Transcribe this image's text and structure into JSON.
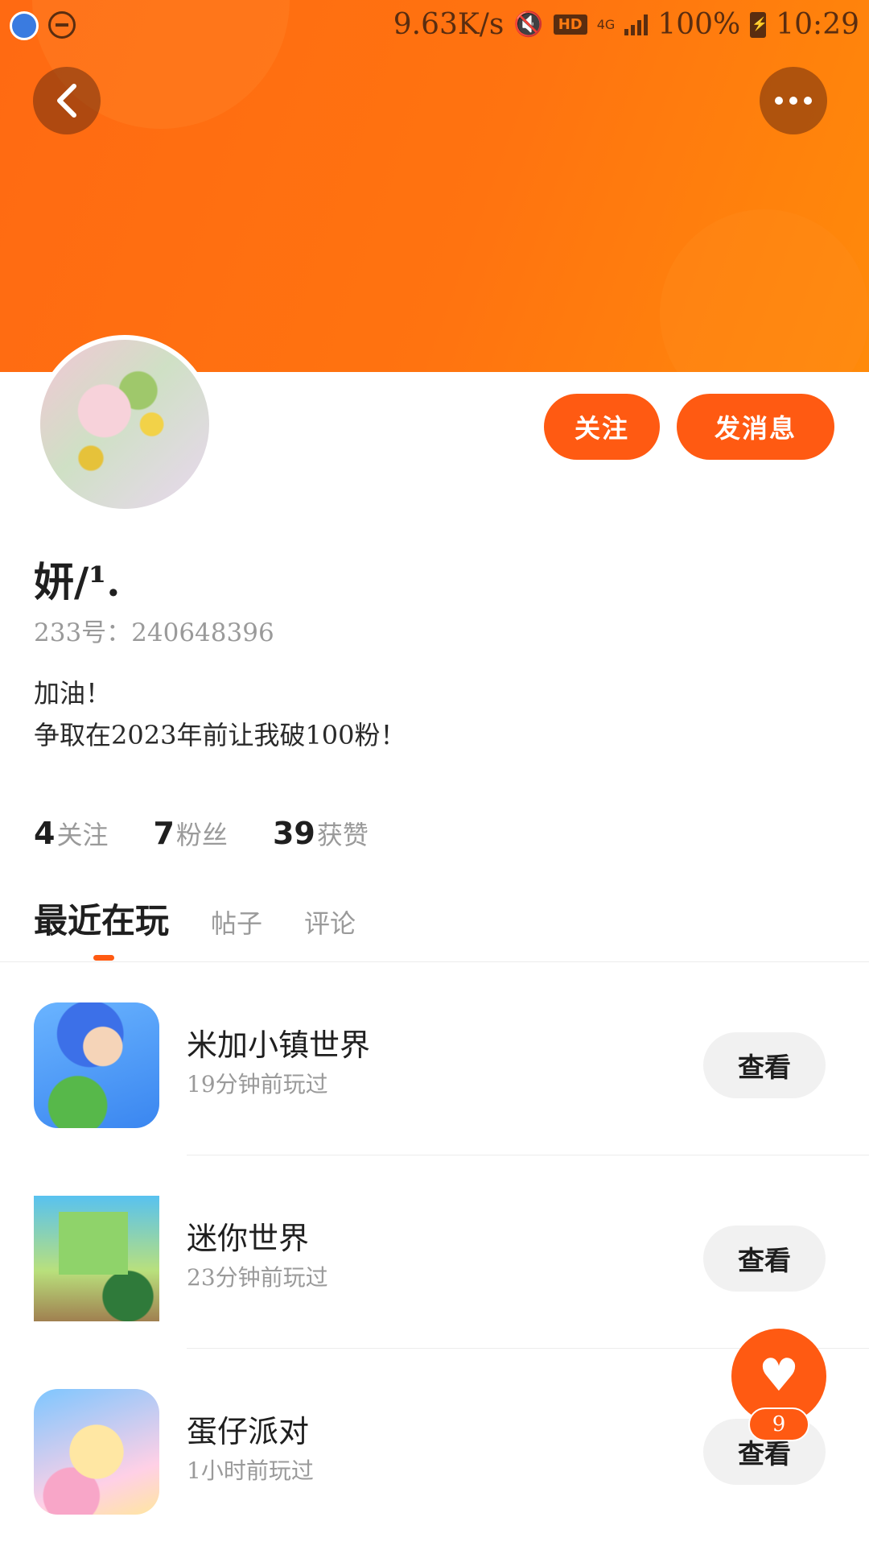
{
  "status_bar": {
    "net_speed": "9.63K/s",
    "hd": "HD",
    "network": "4G",
    "battery": "100%",
    "time": "10:29"
  },
  "header": {
    "back_icon": "chevron-left-icon",
    "more_icon": "more-dots-icon",
    "background_color": "#ff7210"
  },
  "profile": {
    "nickname": "妍/¹.",
    "uid": "233号：240648396",
    "bio_line1": "加油！",
    "bio_line2": "争取在2023年前让我破100粉！",
    "follow_label": "关注",
    "message_label": "发消息"
  },
  "stats": {
    "following_count": "4",
    "following_label": "关注",
    "fans_count": "7",
    "fans_label": "粉丝",
    "likes_count": "39",
    "likes_label": "获赞"
  },
  "tabs": [
    {
      "label": "最近在玩",
      "active": true
    },
    {
      "label": "帖子",
      "active": false
    },
    {
      "label": "评论",
      "active": false
    }
  ],
  "games": [
    {
      "name": "米加小镇世界",
      "time": "19分钟前玩过",
      "action": "查看"
    },
    {
      "name": "迷你世界",
      "time": "23分钟前玩过",
      "action": "查看"
    },
    {
      "name": "蛋仔派对",
      "time": "1小时前玩过",
      "action": "查看"
    }
  ],
  "like_fab": {
    "icon": "heart-icon",
    "count": "9"
  },
  "colors": {
    "accent": "#ff5a12",
    "muted_text": "#9a9a9a"
  }
}
